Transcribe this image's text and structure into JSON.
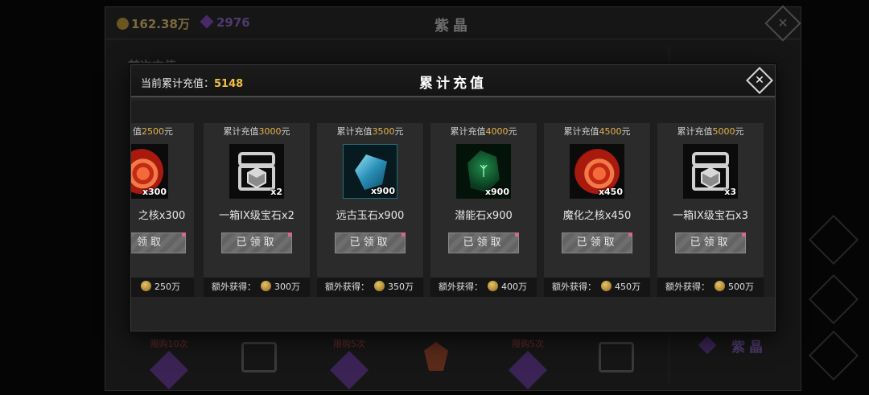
{
  "background": {
    "gold": "162.38万",
    "gems": "2976",
    "title": "紫晶",
    "section_title": "首次充值",
    "side_label": "紫晶",
    "limit_tags": [
      "限购10次",
      "限购5次",
      "限购5次"
    ]
  },
  "modal": {
    "cumulative_label": "当前累计充值：",
    "cumulative_value": "5148",
    "title": "累计充值",
    "close_symbol": "✕"
  },
  "cards": [
    {
      "head_prefix": "值",
      "amount": "2500",
      "head_suffix": "元",
      "icon": "magic-core-orb",
      "qty": "x300",
      "name": "之核x300",
      "button": "领取",
      "bonus_label": "",
      "bonus_value": "250万"
    },
    {
      "head_prefix": "累计充值",
      "amount": "3000",
      "head_suffix": "元",
      "icon": "gem-chest",
      "qty": "x2",
      "name": "一箱IX级宝石x2",
      "button": "已领取",
      "bonus_label": "额外获得：",
      "bonus_value": "300万"
    },
    {
      "head_prefix": "累计充值",
      "amount": "3500",
      "head_suffix": "元",
      "icon": "ancient-jade",
      "qty": "x900",
      "name": "远古玉石x900",
      "button": "已领取",
      "bonus_label": "额外获得：",
      "bonus_value": "350万"
    },
    {
      "head_prefix": "累计充值",
      "amount": "4000",
      "head_suffix": "元",
      "icon": "potential-stone",
      "qty": "x900",
      "name": "潜能石x900",
      "button": "已领取",
      "bonus_label": "额外获得：",
      "bonus_value": "400万"
    },
    {
      "head_prefix": "累计充值",
      "amount": "4500",
      "head_suffix": "元",
      "icon": "magic-core-orb",
      "qty": "x450",
      "name": "魔化之核x450",
      "button": "已领取",
      "bonus_label": "额外获得：",
      "bonus_value": "450万"
    },
    {
      "head_prefix": "累计充值",
      "amount": "5000",
      "head_suffix": "元",
      "icon": "gem-chest",
      "qty": "x3",
      "name": "一箱IX级宝石x3",
      "button": "已领取",
      "bonus_label": "额外获得：",
      "bonus_value": "500万"
    }
  ]
}
